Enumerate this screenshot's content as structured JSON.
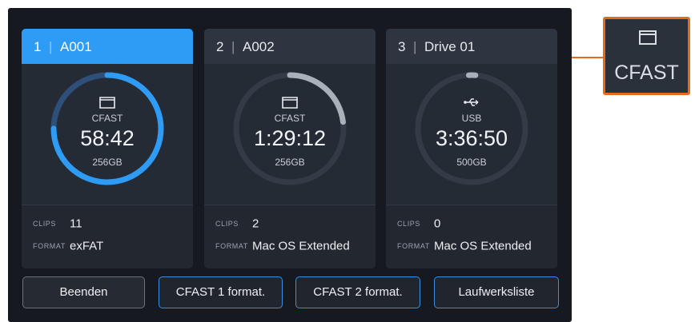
{
  "colors": {
    "accent_blue": "#2e9bf5",
    "button_border_blue": "#3a8fe0",
    "callout_orange": "#e56a1a",
    "panel_bg": "#16191f"
  },
  "cards": [
    {
      "index": "1",
      "name": "A001",
      "icon": "cfast-card-icon",
      "media_type": "CFAST",
      "time_remaining": "58:42",
      "capacity": "256GB",
      "fill_fraction": 0.75,
      "clips_label": "CLIPS",
      "clips_value": "11",
      "format_label": "FORMAT",
      "format_value": "exFAT",
      "active": true
    },
    {
      "index": "2",
      "name": "A002",
      "icon": "cfast-card-icon",
      "media_type": "CFAST",
      "time_remaining": "1:29:12",
      "capacity": "256GB",
      "fill_fraction": 0.23,
      "clips_label": "CLIPS",
      "clips_value": "2",
      "format_label": "FORMAT",
      "format_value": "Mac OS Extended",
      "active": false
    },
    {
      "index": "3",
      "name": "Drive 01",
      "icon": "usb-icon",
      "media_type": "USB",
      "time_remaining": "3:36:50",
      "capacity": "500GB",
      "fill_fraction": 0.02,
      "clips_label": "CLIPS",
      "clips_value": "0",
      "format_label": "FORMAT",
      "format_value": "Mac OS Extended",
      "active": false
    }
  ],
  "buttons": {
    "exit": "Beenden",
    "format_cfast1": "CFAST 1 format.",
    "format_cfast2": "CFAST 2 format.",
    "drive_list": "Laufwerksliste"
  },
  "callout": {
    "icon": "cfast-card-icon",
    "label": "CFAST"
  },
  "separator": "|"
}
